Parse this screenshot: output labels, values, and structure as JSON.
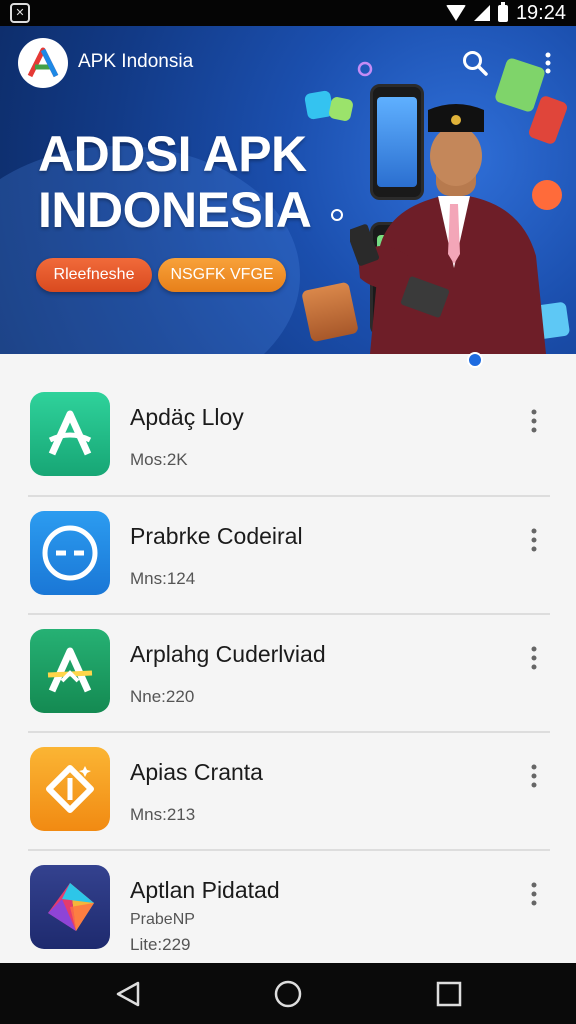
{
  "status_bar": {
    "time": "19:24"
  },
  "header": {
    "brand": "APK Indonsia"
  },
  "banner": {
    "headline_line1": "ADDSI APK",
    "headline_line2": "INDONESIA",
    "pill_left": "Rleefneshe",
    "pill_right": "NSGFK VFGE"
  },
  "apps": [
    {
      "name": "Apdäç Lloy",
      "meta": "Mos:2K",
      "icon": "a-logo-icon",
      "color": "#1fb482"
    },
    {
      "name": "Prabrke Codeiral",
      "meta": "Mns:124",
      "icon": "minus-circle-icon",
      "color": "#1e88e5"
    },
    {
      "name": "Arplahg Cuderlviad",
      "meta": "Nne:220",
      "icon": "a-star-logo-icon",
      "color": "#1b9b63"
    },
    {
      "name": "Apias Cranta",
      "meta": "Mns:213",
      "icon": "diamond-logo-icon",
      "color": "#f7a21b"
    },
    {
      "name": "Aptlan Pidatad",
      "sub": "PrabeNP",
      "meta": "Lite:229",
      "icon": "prism-logo-icon",
      "color": "#2d3a8c"
    }
  ],
  "colors": {
    "accent": "#1d6be0",
    "banner": "#1b4fae"
  }
}
